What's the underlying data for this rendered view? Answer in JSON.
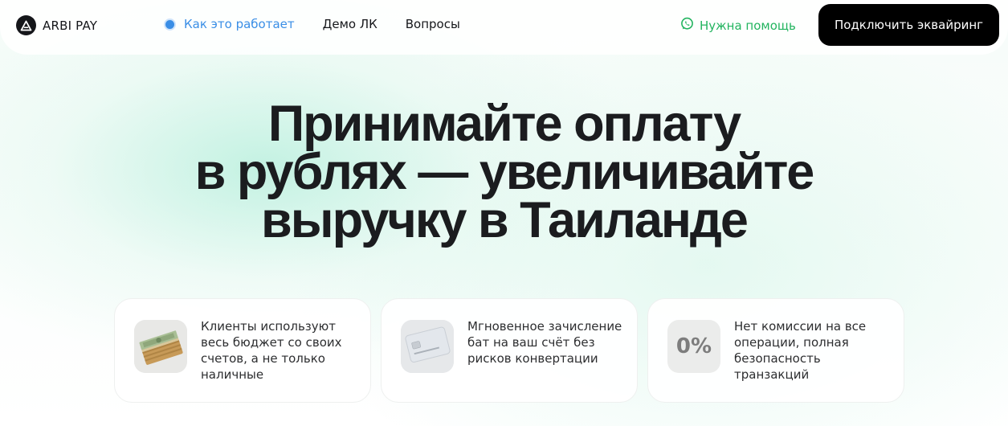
{
  "brand": {
    "name": "ARBI PAY"
  },
  "nav": {
    "items": [
      {
        "label": "Как это работает",
        "active": true
      },
      {
        "label": "Демо ЛК",
        "active": false
      },
      {
        "label": "Вопросы",
        "active": false
      }
    ]
  },
  "help": {
    "label": "Нужна помощь",
    "icon": "whatsapp-icon",
    "color": "#23b45f"
  },
  "cta": {
    "label": "Подключить эквайринг"
  },
  "hero": {
    "lines": [
      "Принимайте оплату",
      "в рублях — увеличивайте",
      "выручку в Таиланде"
    ]
  },
  "features": [
    {
      "icon": "money-stack-icon",
      "text": "Клиенты используют весь бюджет со своих счетов, а не только наличные"
    },
    {
      "icon": "bank-card-icon",
      "text": "Мгновенное зачисление бат на ваш счёт без рисков конвертации"
    },
    {
      "icon": "zero-percent-icon",
      "badge": "0%",
      "text": "Нет комиссии на все операции, полная безопасность транзакций"
    }
  ],
  "colors": {
    "accent": "#3a8ee6",
    "whatsapp": "#23b45f",
    "cta_bg": "#000000"
  }
}
